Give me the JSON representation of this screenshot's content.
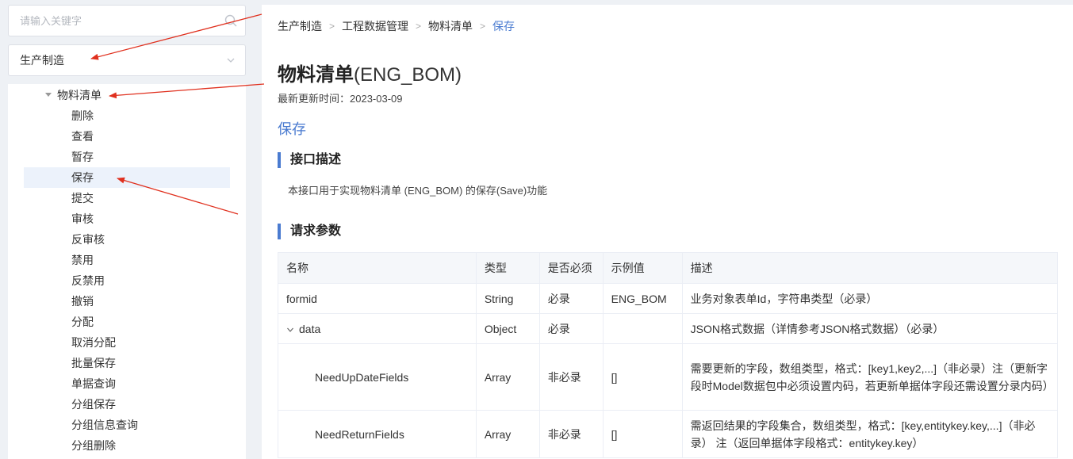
{
  "search": {
    "placeholder": "请输入关键字"
  },
  "module_select": {
    "value": "生产制造"
  },
  "tree": {
    "parent": "物料清单",
    "children": [
      "删除",
      "查看",
      "暂存",
      "保存",
      "提交",
      "审核",
      "反审核",
      "禁用",
      "反禁用",
      "撤销",
      "分配",
      "取消分配",
      "批量保存",
      "单据查询",
      "分组保存",
      "分组信息查询",
      "分组删除"
    ],
    "active_index": 3
  },
  "breadcrumb": [
    "生产制造",
    "工程数据管理",
    "物料清单",
    "保存"
  ],
  "page": {
    "title": "物料清单",
    "code": "(ENG_BOM)",
    "update_time": "最新更新时间：2023-03-09",
    "operation": "保存"
  },
  "sections": {
    "interface_desc_title": "接口描述",
    "interface_desc": "本接口用于实现物料清单 (ENG_BOM) 的保存(Save)功能",
    "request_params_title": "请求参数"
  },
  "table": {
    "headers": [
      "名称",
      "类型",
      "是否必须",
      "示例值",
      "描述"
    ],
    "rows": [
      {
        "name": "formid",
        "type": "String",
        "required": "必录",
        "example": "ENG_BOM",
        "desc": "业务对象表单Id，字符串类型（必录）"
      },
      {
        "name": "data",
        "type": "Object",
        "required": "必录",
        "example": "",
        "desc": "JSON格式数据（详情参考JSON格式数据）（必录）"
      },
      {
        "name": "NeedUpDateFields",
        "type": "Array",
        "required": "非必录",
        "example": "[]",
        "desc": "需要更新的字段，数组类型，格式：[key1,key2,...]（非必录）注（更新字段时Model数据包中必须设置内码，若更新单据体字段还需设置分录内码）"
      },
      {
        "name": "NeedReturnFields",
        "type": "Array",
        "required": "非必录",
        "example": "[]",
        "desc": "需返回结果的字段集合，数组类型，格式：[key,entitykey.key,...]（非必录） 注（返回单据体字段格式：entitykey.key）"
      }
    ]
  },
  "colors": {
    "accent": "#4a7bd0",
    "annotation_arrow": "#e0301e"
  }
}
